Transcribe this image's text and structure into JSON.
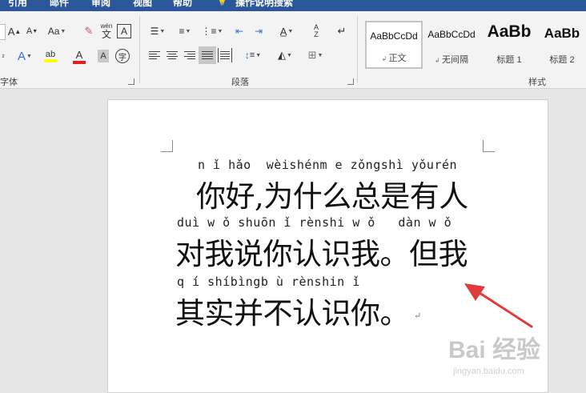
{
  "tabs": [
    "引用",
    "邮件",
    "审阅",
    "视图",
    "帮助",
    "操作说明搜索"
  ],
  "ribbon": {
    "font_group_label": "字体",
    "paragraph_group_label": "段落",
    "styles_group_label": "样式",
    "font_buttons": {
      "grow": "A",
      "shrink": "A",
      "case": "Aa",
      "phonetic_top": "wén",
      "phonetic_char": "文",
      "char_border": "A",
      "text_effects": "A",
      "highlight": "ab",
      "font_color": "A",
      "char_shading": "A",
      "enclose": "字"
    },
    "styles": [
      {
        "sample": "AaBbCcDd",
        "name": "正文",
        "selected": true
      },
      {
        "sample": "AaBbCcDd",
        "name": "无间隔",
        "selected": false
      },
      {
        "sample": "AaBb",
        "name": "标题 1",
        "selected": false
      },
      {
        "sample": "AaBb",
        "name": "标题 2",
        "selected": false
      }
    ]
  },
  "document": {
    "lines": [
      {
        "pinyin": "n ǐ hǎo  wèishénm e zǒngshì yǒurén",
        "text": "你好,为什么总是有人"
      },
      {
        "pinyin": "duì w ǒ shuōn ǐ rènshi w ǒ   dàn w ǒ",
        "text": "对我说你认识我。但我"
      },
      {
        "pinyin": "q í shíbìngb ù rènshin ǐ",
        "text": "其实并不认识你。"
      }
    ],
    "paragraph_mark": "↵"
  },
  "watermark": {
    "brand": "Bai 经验",
    "url": "jingyan.baidu.com"
  },
  "colors": {
    "title_bar": "#2b579a",
    "ribbon_bg": "#f3f3f3",
    "highlight": "#ffff00",
    "font_color_bar": "#e02020",
    "arrow": "#e03b3b"
  }
}
